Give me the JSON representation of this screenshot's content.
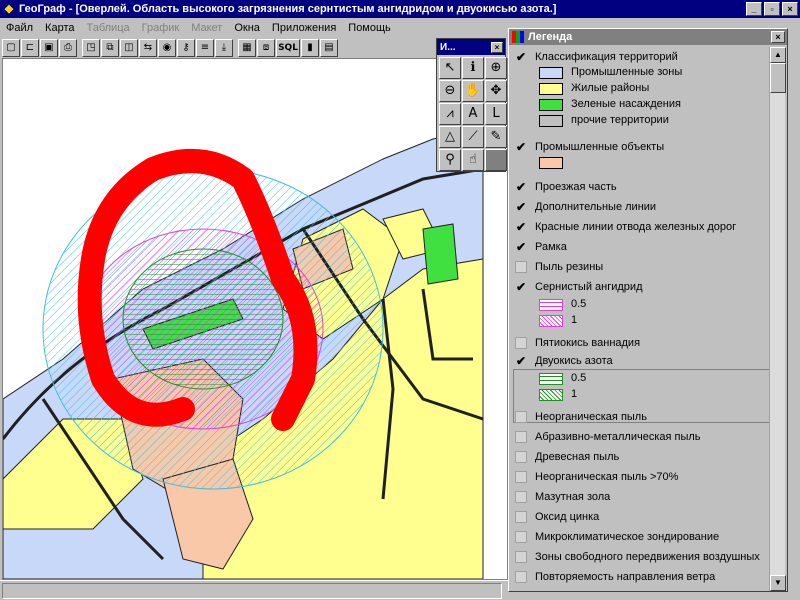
{
  "window": {
    "app_name": "ГеоГраф",
    "title": "ГеоГраф - [Оверлей. Область высокого загрязнения сернтистым ангидридом и двуокисью азота.]",
    "minimize": "_",
    "restore": "▫",
    "close": "×"
  },
  "menu": [
    {
      "label": "Файл",
      "enabled": true
    },
    {
      "label": "Карта",
      "enabled": true
    },
    {
      "label": "Таблица",
      "enabled": false
    },
    {
      "label": "График",
      "enabled": false
    },
    {
      "label": "Макет",
      "enabled": false
    },
    {
      "label": "Окна",
      "enabled": true
    },
    {
      "label": "Приложения",
      "enabled": true
    },
    {
      "label": "Помощь",
      "enabled": true
    }
  ],
  "toolbar": {
    "sql_label": "SQL",
    "icons": [
      "new-file-icon",
      "open-folder-icon",
      "save-icon",
      "print-icon",
      "window-icon",
      "copy-icon",
      "arrange-icon",
      "swap-icon",
      "layers-icon",
      "key-icon",
      "list-icon",
      "download-icon",
      "table-icon",
      "stack-icon",
      "sql-icon",
      "bar-chart-icon",
      "document-icon"
    ]
  },
  "tool_palette": {
    "title": "И...",
    "close": "×",
    "tools": [
      {
        "name": "pointer-tool",
        "glyph": "↖"
      },
      {
        "name": "info-tool",
        "glyph": "ℹ"
      },
      {
        "name": "zoom-in-tool",
        "glyph": "⊕"
      },
      {
        "name": "zoom-out-tool",
        "glyph": "⊖"
      },
      {
        "name": "pan-tool",
        "glyph": "✋"
      },
      {
        "name": "full-extent-tool",
        "glyph": "✥"
      },
      {
        "name": "graph-tool",
        "glyph": "⩘"
      },
      {
        "name": "text-tool",
        "glyph": "A"
      },
      {
        "name": "label-tool",
        "glyph": "L"
      },
      {
        "name": "measure-tool",
        "glyph": "△"
      },
      {
        "name": "select-line-tool",
        "glyph": "⟋"
      },
      {
        "name": "pen-tool",
        "glyph": "✎"
      },
      {
        "name": "find-tool",
        "glyph": "⚲"
      },
      {
        "name": "hand-point-tool",
        "glyph": "☝"
      },
      {
        "name": "blank-tool",
        "glyph": ""
      }
    ]
  },
  "legend": {
    "title": "Легенда",
    "close": "×",
    "layers": [
      {
        "label": "Классификация территорий",
        "checked": true
      },
      {
        "label": "Промышленные зоны",
        "swatch": "#c8d8f8"
      },
      {
        "label": "Жилые районы",
        "swatch": "#ffff90"
      },
      {
        "label": "Зеленые насаждения",
        "swatch": "#40e040"
      },
      {
        "label": "прочие территории",
        "swatch": "#c0c0c0"
      },
      {
        "label": "Промышленные объекты",
        "checked": true
      },
      {
        "label": "Проезжая часть",
        "checked": true
      },
      {
        "label": "Дополнительные линии",
        "checked": true
      },
      {
        "label": "Красные линии отвода железных дорог",
        "checked": true
      },
      {
        "label": "Рамка",
        "checked": true
      },
      {
        "label": "Пыль резины",
        "checked": false
      },
      {
        "label": "Сернистый ангидрид",
        "checked": true
      },
      {
        "label": "0.5"
      },
      {
        "label": "1"
      },
      {
        "label": "Пятиокись ваннадия",
        "checked": false
      },
      {
        "label": "Двуокись азота",
        "checked": true
      },
      {
        "label": "0.5"
      },
      {
        "label": "1"
      },
      {
        "label": "Неорганическая пыль",
        "checked": false
      },
      {
        "label": "Абразивно-металлическая пыль",
        "checked": false
      },
      {
        "label": "Древесная пыль",
        "checked": false
      },
      {
        "label": "Неорганическая пыль >70%",
        "checked": false
      },
      {
        "label": "Мазутная зола",
        "checked": false
      },
      {
        "label": "Оксид цинка",
        "checked": false
      },
      {
        "label": "Микроклиматическое зондирование",
        "checked": false
      },
      {
        "label": "Зоны свободного передвижения воздушных",
        "checked": false
      },
      {
        "label": "Повторяемость направления ветра",
        "checked": false
      }
    ],
    "colors": {
      "industrial_object": "#f8c8a8",
      "so2_hatch": "#e040e0",
      "no2_hatch": "#209020"
    }
  },
  "map_colors": {
    "residential": "#ffff90",
    "industrial": "#c8d8f8",
    "green": "#40e040",
    "object": "#f8c8a8",
    "road": "#202020",
    "hazard": "#ff0000",
    "cyan_hatch": "#40c0e0"
  }
}
